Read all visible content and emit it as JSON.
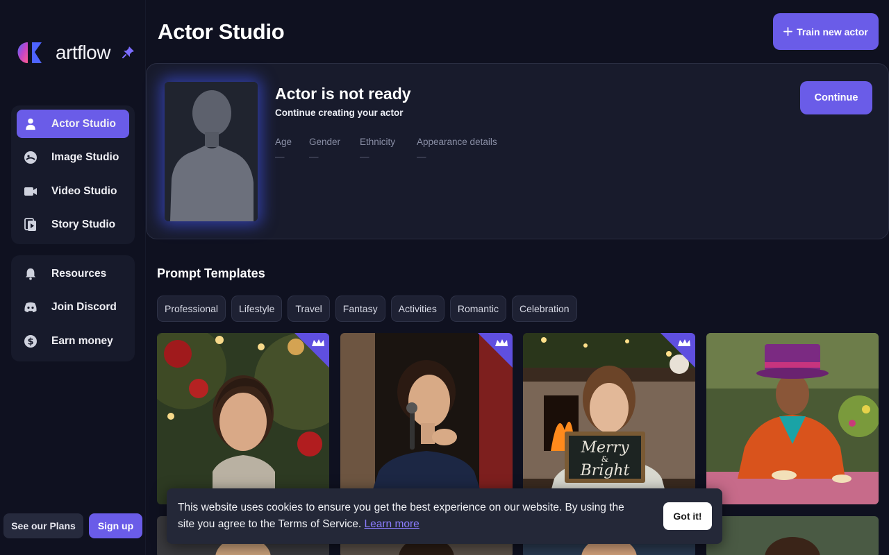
{
  "brand": {
    "name": "artflow",
    "accent": "#6a5ce8"
  },
  "sidebar": {
    "primary": [
      {
        "label": "Actor Studio",
        "icon": "user-icon",
        "active": true
      },
      {
        "label": "Image Studio",
        "icon": "image-studio-icon"
      },
      {
        "label": "Video Studio",
        "icon": "video-camera-icon"
      },
      {
        "label": "Story Studio",
        "icon": "story-icon"
      }
    ],
    "secondary": [
      {
        "label": "Resources",
        "icon": "bell-icon"
      },
      {
        "label": "Join Discord",
        "icon": "discord-icon"
      },
      {
        "label": "Earn money",
        "icon": "dollar-icon"
      }
    ],
    "plans_label": "See our Plans",
    "signup_label": "Sign up"
  },
  "header": {
    "title": "Actor Studio",
    "train_label": "Train new actor"
  },
  "actor_card": {
    "title": "Actor is not ready",
    "subtitle": "Continue creating your actor",
    "continue_label": "Continue",
    "attributes": [
      {
        "label": "Age",
        "value": "—"
      },
      {
        "label": "Gender",
        "value": "—"
      },
      {
        "label": "Ethnicity",
        "value": "—"
      },
      {
        "label": "Appearance details",
        "value": "—"
      }
    ]
  },
  "templates": {
    "title": "Prompt Templates",
    "categories": [
      "Professional",
      "Lifestyle",
      "Travel",
      "Fantasy",
      "Activities",
      "Romantic",
      "Celebration"
    ],
    "cards": [
      {
        "name": "christmas-portrait",
        "premium": true
      },
      {
        "name": "public-speaker",
        "premium": true
      },
      {
        "name": "merry-bright-fireplace",
        "premium": true,
        "sign_text": [
          "Merry",
          "&",
          "Bright"
        ]
      },
      {
        "name": "mad-hatter-tea-party",
        "premium": false
      }
    ]
  },
  "cookie": {
    "text": "This website uses cookies to ensure you get the best experience on our website. By using the site you agree to the Terms of Service.",
    "link_label": "Learn more",
    "button_label": "Got it!"
  }
}
